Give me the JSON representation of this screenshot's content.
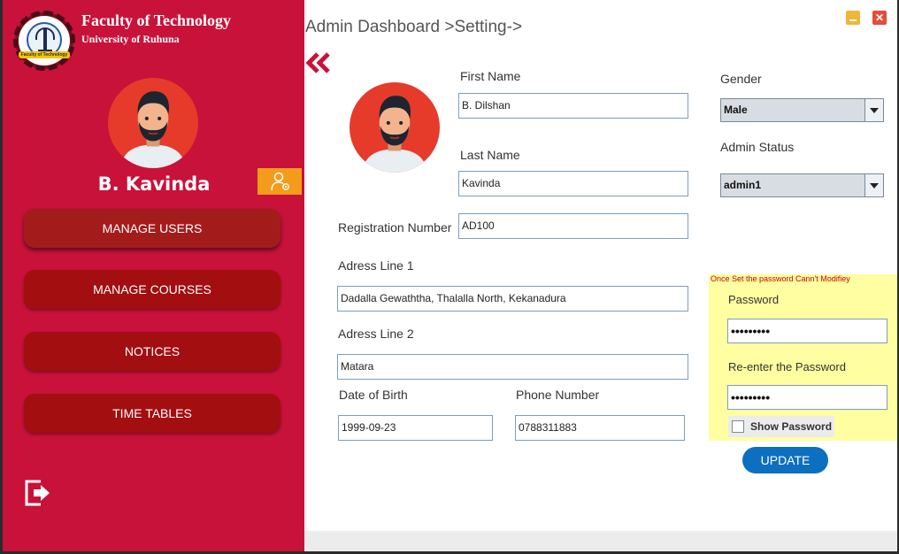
{
  "sidebar": {
    "logo": {
      "text": "Faculty of Technology"
    },
    "title": "Faculty of Technology",
    "subtitle": "University of Ruhuna",
    "user_name": "B. Kavinda",
    "nav": [
      {
        "label": "MANAGE USERS",
        "active": true
      },
      {
        "label": "MANAGE COURSES",
        "active": false
      },
      {
        "label": "NOTICES",
        "active": false
      },
      {
        "label": "TIME TABLES",
        "active": false
      }
    ],
    "icons": {
      "profile_settings": "user-gear-icon",
      "logout": "logout-icon"
    }
  },
  "header": {
    "title": "Admin Dashboard >Setting->",
    "back_icon": "double-chevron-left-icon",
    "window_controls": {
      "minimize": "minimize-icon",
      "close": "✕"
    }
  },
  "form": {
    "first_name": {
      "label": "First Name",
      "value": "B. Dilshan"
    },
    "last_name": {
      "label": "Last Name",
      "value": "Kavinda"
    },
    "registration_number": {
      "label": "Registration Number",
      "value": "AD100"
    },
    "address_line_1": {
      "label": "Adress Line 1",
      "value": "Dadalla Gewaththa, Thalalla North, Kekanadura"
    },
    "address_line_2": {
      "label": "Adress Line 2",
      "value": "Matara"
    },
    "date_of_birth": {
      "label": "Date of Birth",
      "value": "1999-09-23"
    },
    "phone_number": {
      "label": "Phone Number",
      "value": "0788311883"
    },
    "gender": {
      "label": "Gender",
      "selected": "Male"
    },
    "admin_status": {
      "label": "Admin Status",
      "selected": "admin1"
    }
  },
  "password_panel": {
    "note": "Once Set the password Cann't Modifiey",
    "password_label": "Password",
    "password_value": "•••••••••",
    "reenter_label": "Re-enter the Password",
    "reenter_value": "•••••••••",
    "show_password_label": "Show Password",
    "show_password_checked": false
  },
  "update_button": "UPDATE",
  "colors": {
    "sidebar": "#c8123a",
    "nav_button": "#a30e10",
    "accent_orange": "#f39c1c",
    "update_button": "#0c6fbf",
    "password_panel": "#fffea1"
  }
}
